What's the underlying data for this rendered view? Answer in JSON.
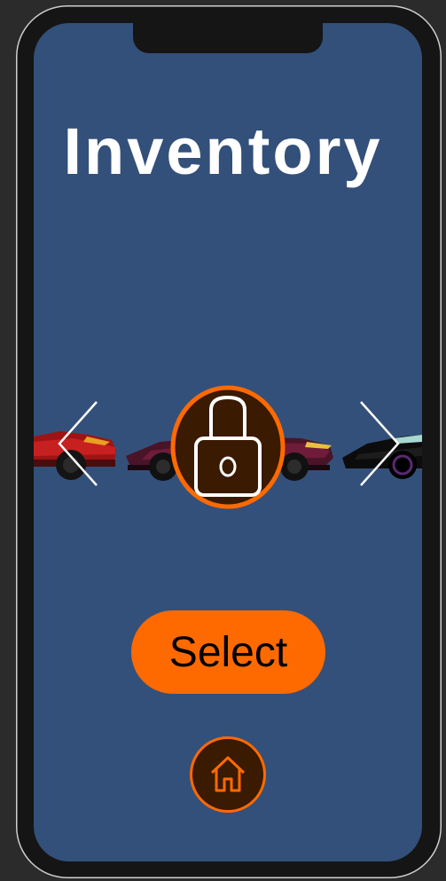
{
  "header": {
    "title": "Inventory"
  },
  "carousel": {
    "prev_icon": "chevron-left-icon",
    "next_icon": "chevron-right-icon",
    "lock_icon": "padlock-icon",
    "cars": [
      {
        "position": "left",
        "color": "#b01818"
      },
      {
        "position": "center",
        "color": "#5a1830"
      },
      {
        "position": "right",
        "color": "#0d0d0d"
      }
    ]
  },
  "actions": {
    "select_label": "Select",
    "home_icon": "home-icon"
  },
  "colors": {
    "accent": "#ff6a00",
    "background": "#33507a",
    "badge_fill": "#3a1a00",
    "title": "#ffffff"
  }
}
